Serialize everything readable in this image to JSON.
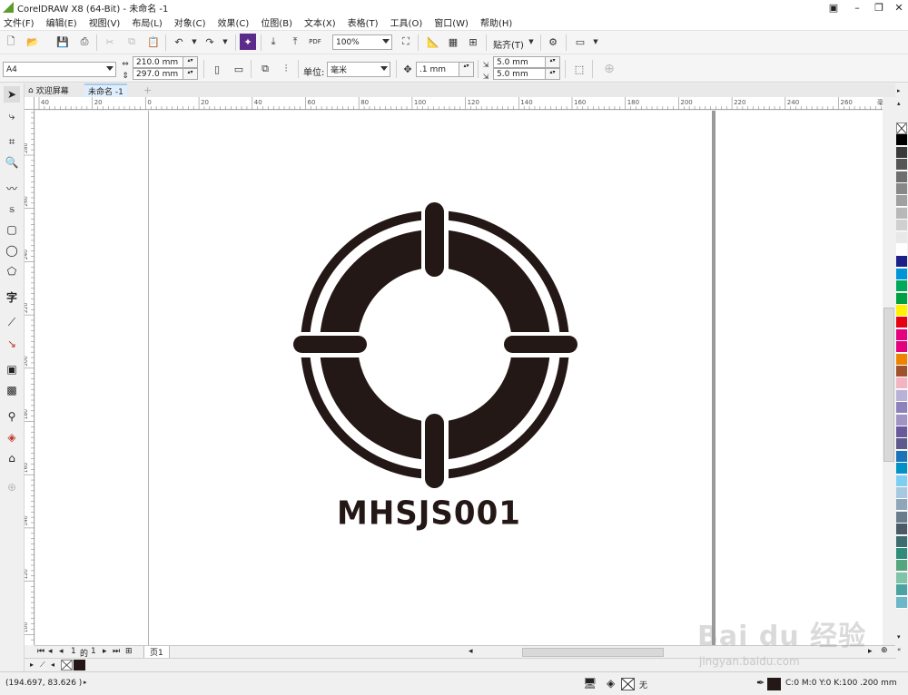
{
  "window": {
    "title": "CorelDRAW X8 (64-Bit) - 未命名 -1"
  },
  "menu": [
    "文件(F)",
    "编辑(E)",
    "视图(V)",
    "布局(L)",
    "对象(C)",
    "效果(C)",
    "位图(B)",
    "文本(X)",
    "表格(T)",
    "工具(O)",
    "窗口(W)",
    "帮助(H)"
  ],
  "toolbar": {
    "pdf_label": "PDF",
    "zoom": "100%",
    "snap_label": "贴齐(T)"
  },
  "property_bar": {
    "page_size": "A4",
    "width": "210.0 mm",
    "height": "297.0 mm",
    "units_label": "单位:",
    "units": "毫米",
    "nudge": ".1 mm",
    "dup_x": "5.0 mm",
    "dup_y": "5.0 mm"
  },
  "doc_tabs": [
    "欢迎屏幕",
    "未命名 -1"
  ],
  "hruler_labels": [
    "40",
    "20",
    "0",
    "20",
    "40",
    "60",
    "80",
    "100",
    "120",
    "140",
    "160",
    "180",
    "200",
    "220",
    "240",
    "260",
    "毫米"
  ],
  "vruler_labels": [
    "280",
    "260",
    "240",
    "220",
    "200",
    "180",
    "160",
    "140",
    "120",
    "100"
  ],
  "artwork": {
    "text": "MHSJS001",
    "color": "#231815"
  },
  "page_nav": {
    "current": "1",
    "of_label": "的",
    "total": "1",
    "page_tab": "页1"
  },
  "status": {
    "coords": "(194.697, 83.626 )",
    "fill_none": "无",
    "outline": "C:0 M:0 Y:0 K:100  .200 mm"
  },
  "palette_colors": [
    "#ffffff",
    "#000000",
    "#3a3a3a",
    "#555555",
    "#6e6e6e",
    "#888888",
    "#a0a0a0",
    "#b8b8b8",
    "#d0d0d0",
    "#e8e8e8",
    "#ffffff",
    "#1d2088",
    "#0095d9",
    "#00a85a",
    "#00a040",
    "#fff100",
    "#e60012",
    "#e4007f",
    "#e4007f",
    "#f08300",
    "#a0522d",
    "#f4b3c2",
    "#b8b2d8",
    "#8e82bc",
    "#a094c5",
    "#6a5a9c",
    "#5e5a8c",
    "#1d73b8",
    "#0092c7",
    "#7ecef4",
    "#a6c8e0",
    "#8fa5b8",
    "#6a7d8c",
    "#4a5a66",
    "#3c6e71",
    "#2f8b7a",
    "#55a57f",
    "#7fc3a8",
    "#4aa3a0",
    "#6db7c9"
  ],
  "watermark": {
    "brand": "Bai du 经验",
    "url": "jingyan.baidu.com"
  }
}
